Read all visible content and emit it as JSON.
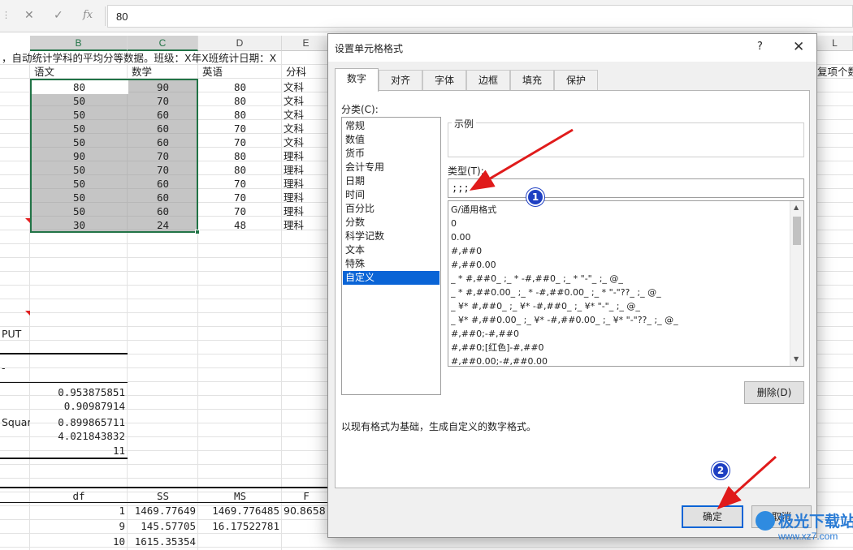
{
  "formula_bar": {
    "cancel_icon": "✕",
    "enter_icon": "✓",
    "fx_icon": "fx",
    "value": "80"
  },
  "columns": [
    "B",
    "C",
    "D",
    "E",
    "L"
  ],
  "sheet": {
    "row1_text": "，自动统计学科的平均分等数据。班级：X年X班统计日期：X",
    "row1_right": "复项个数",
    "headers": [
      "语文",
      "数学",
      "英语",
      "分科"
    ],
    "rows": [
      [
        "80",
        "90",
        "80",
        "文科"
      ],
      [
        "50",
        "70",
        "80",
        "文科"
      ],
      [
        "50",
        "60",
        "80",
        "文科"
      ],
      [
        "50",
        "60",
        "70",
        "文科"
      ],
      [
        "50",
        "60",
        "70",
        "文科"
      ],
      [
        "90",
        "70",
        "80",
        "理科"
      ],
      [
        "50",
        "70",
        "80",
        "理科"
      ],
      [
        "50",
        "60",
        "70",
        "理科"
      ],
      [
        "50",
        "60",
        "70",
        "理科"
      ],
      [
        "50",
        "60",
        "70",
        "理科"
      ],
      [
        "30",
        "24",
        "48",
        "理科"
      ]
    ],
    "output_label": "PUT",
    "dash_label": "-",
    "stats": [
      "0.953875851",
      "0.90987914",
      "0.899865711",
      "4.021843832",
      "11"
    ],
    "squar_label": "Squar",
    "anova_headers": [
      "df",
      "SS",
      "MS",
      "F"
    ],
    "anova_rows": [
      [
        "1",
        "1469.77649",
        "1469.776485",
        "90.8658"
      ],
      [
        "9",
        "145.57705",
        "16.17522781",
        ""
      ],
      [
        "10",
        "1615.35354",
        "",
        ""
      ]
    ]
  },
  "dialog": {
    "title": "设置单元格格式",
    "help": "?",
    "close": "✕",
    "tabs": [
      "数字",
      "对齐",
      "字体",
      "边框",
      "填充",
      "保护"
    ],
    "category_label": "分类(C):",
    "categories": [
      "常规",
      "数值",
      "货币",
      "会计专用",
      "日期",
      "时间",
      "百分比",
      "分数",
      "科学记数",
      "文本",
      "特殊",
      "自定义"
    ],
    "selected_category": 11,
    "sample_label": "示例",
    "type_label": "类型(T):",
    "type_value": ";;;",
    "formats": [
      "G/通用格式",
      "0",
      "0.00",
      "#,##0",
      "#,##0.00",
      "_ * #,##0_ ;_ * -#,##0_ ;_ * \"-\"_ ;_ @_",
      "_ * #,##0.00_ ;_ * -#,##0.00_ ;_ * \"-\"??_ ;_ @_",
      "_ ¥* #,##0_ ;_ ¥* -#,##0_ ;_ ¥* \"-\"_ ;_ @_",
      "_ ¥* #,##0.00_ ;_ ¥* -#,##0.00_ ;_ ¥* \"-\"??_ ;_ @_",
      "#,##0;-#,##0",
      "#,##0;[红色]-#,##0",
      "#,##0.00;-#,##0.00"
    ],
    "delete_button": "删除(D)",
    "description": "以现有格式为基础，生成自定义的数字格式。",
    "ok_button": "确定",
    "cancel_button": "取消"
  },
  "annotations": {
    "badge1": "1",
    "badge2": "2",
    "arrow_color": "#e01b1b"
  },
  "watermark": {
    "name": "极光下载站",
    "url": "www.xz7.com"
  },
  "colors": {
    "selection_border": "#217346",
    "list_selection": "#0a64d6",
    "badge": "#1e3fc2"
  }
}
